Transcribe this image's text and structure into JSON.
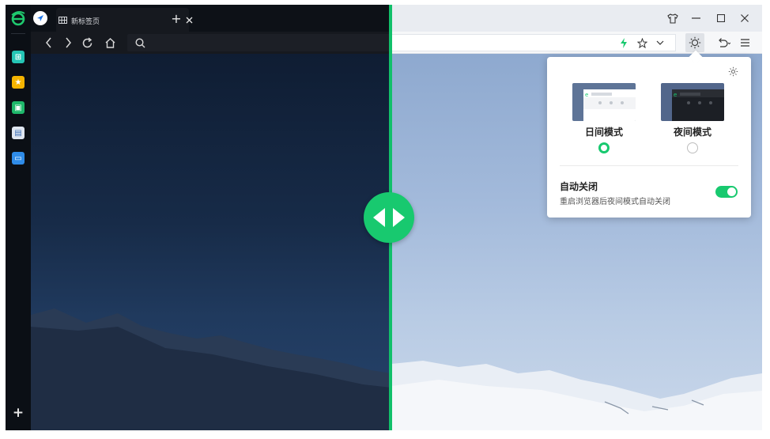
{
  "tab": {
    "title": "新标签页",
    "add_label": "+"
  },
  "sidebar": {
    "add_label": "+"
  },
  "popup": {
    "day_label": "日间模式",
    "night_label": "夜间模式",
    "selected": "day",
    "auto_title": "自动关闭",
    "auto_desc": "重启浏览器后夜间模式自动关闭",
    "auto_enabled": true
  },
  "colors": {
    "accent": "#18c96f",
    "dark_bg": "#0b0f15",
    "light_bg": "#eef1f5"
  },
  "icons": [
    "ie-logo-icon",
    "app-icon",
    "favorites-icon",
    "tools-icon",
    "notes-icon",
    "tv-icon",
    "compass-icon",
    "grid-icon",
    "close-icon",
    "back-icon",
    "forward-icon",
    "reload-icon",
    "home-icon",
    "search-icon",
    "shirt-icon",
    "minimize-icon",
    "maximize-icon",
    "window-close-icon",
    "lightning-icon",
    "star-icon",
    "chevron-down-icon",
    "sun-icon",
    "undo-icon",
    "menu-icon",
    "settings-icon",
    "compare-arrows-icon"
  ]
}
